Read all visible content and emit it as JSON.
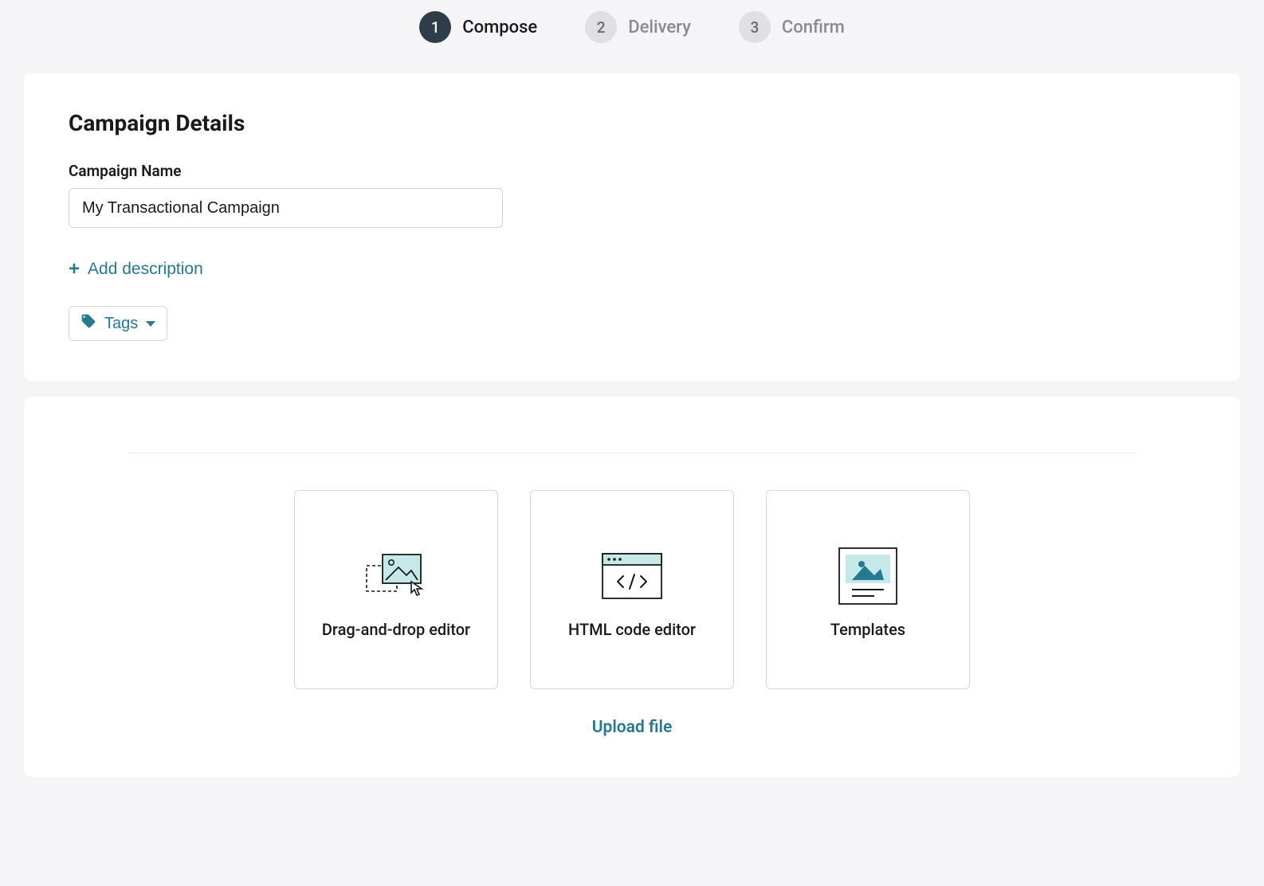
{
  "stepper": {
    "steps": [
      {
        "num": "1",
        "label": "Compose",
        "active": true
      },
      {
        "num": "2",
        "label": "Delivery",
        "active": false
      },
      {
        "num": "3",
        "label": "Confirm",
        "active": false
      }
    ]
  },
  "details": {
    "section_title": "Campaign Details",
    "name_label": "Campaign Name",
    "name_value": "My Transactional Campaign",
    "add_description": "Add description",
    "tags_label": "Tags"
  },
  "editors": {
    "options": [
      {
        "label": "Drag-and-drop editor"
      },
      {
        "label": "HTML code editor"
      },
      {
        "label": "Templates"
      }
    ],
    "upload_label": "Upload file"
  },
  "colors": {
    "accent": "#247a91",
    "step_active_bg": "#2d3e4a",
    "light_teal": "#c5e8ea"
  }
}
